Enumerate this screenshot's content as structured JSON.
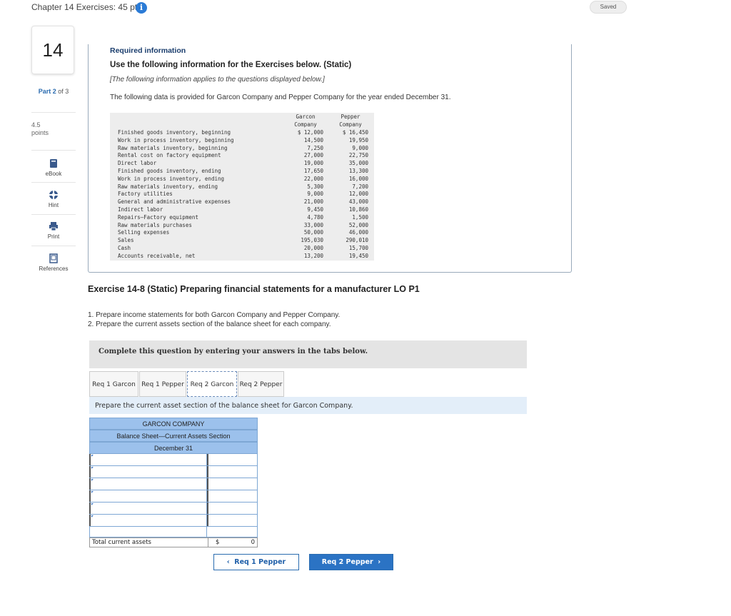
{
  "header": {
    "title": "Chapter 14 Exercises: 45 pts",
    "info_icon": "i",
    "saved": "Saved"
  },
  "sidebar": {
    "question_number": "14",
    "part_prefix": "Part ",
    "part_current": "2",
    "part_suffix": " of 3",
    "points_value": "4.5",
    "points_label": "points",
    "tools": [
      {
        "icon": "ebook-icon",
        "label": "eBook"
      },
      {
        "icon": "hint-icon",
        "label": "Hint"
      },
      {
        "icon": "print-icon",
        "label": "Print"
      },
      {
        "icon": "references-icon",
        "label": "References"
      }
    ]
  },
  "info": {
    "required": "Required information",
    "heading": "Use the following information for the Exercises below. (Static)",
    "applies": "[The following information applies to the questions displayed below.]",
    "provided": "The following data is provided for Garcon Company and Pepper Company for the year ended December 31.",
    "table": {
      "col1": [
        "Garcon",
        "Company"
      ],
      "col2": [
        "Pepper",
        "Company"
      ],
      "rows": [
        {
          "label": "Finished goods inventory, beginning",
          "garcon": "$ 12,000",
          "pepper": "$ 16,450"
        },
        {
          "label": "Work in process inventory, beginning",
          "garcon": "14,500",
          "pepper": "19,950"
        },
        {
          "label": "Raw materials inventory, beginning",
          "garcon": "7,250",
          "pepper": "9,000"
        },
        {
          "label": "Rental cost on factory equipment",
          "garcon": "27,000",
          "pepper": "22,750"
        },
        {
          "label": "Direct labor",
          "garcon": "19,000",
          "pepper": "35,000"
        },
        {
          "label": "Finished goods inventory, ending",
          "garcon": "17,650",
          "pepper": "13,300"
        },
        {
          "label": "Work in process inventory, ending",
          "garcon": "22,000",
          "pepper": "16,000"
        },
        {
          "label": "Raw materials inventory, ending",
          "garcon": "5,300",
          "pepper": "7,200"
        },
        {
          "label": "Factory utilities",
          "garcon": "9,000",
          "pepper": "12,000"
        },
        {
          "label": "General and administrative expenses",
          "garcon": "21,000",
          "pepper": "43,000"
        },
        {
          "label": "Indirect labor",
          "garcon": "9,450",
          "pepper": "10,860"
        },
        {
          "label": "Repairs—Factory equipment",
          "garcon": "4,780",
          "pepper": "1,500"
        },
        {
          "label": "Raw materials purchases",
          "garcon": "33,000",
          "pepper": "52,000"
        },
        {
          "label": "Selling expenses",
          "garcon": "50,000",
          "pepper": "46,000"
        },
        {
          "label": "Sales",
          "garcon": "195,030",
          "pepper": "290,010"
        },
        {
          "label": "Cash",
          "garcon": "20,000",
          "pepper": "15,700"
        },
        {
          "label": "Accounts receivable, net",
          "garcon": "13,200",
          "pepper": "19,450"
        }
      ]
    }
  },
  "exercise": {
    "title": "Exercise 14-8 (Static) Preparing financial statements for a manufacturer LO P1",
    "instructions": [
      "1. Prepare income statements for both Garcon Company and Pepper Company.",
      "2. Prepare the current assets section of the balance sheet for each company."
    ],
    "complete": "Complete this question by entering your answers in the tabs below.",
    "tabs": [
      "Req 1 Garcon",
      "Req 1 Pepper",
      "Req 2 Garcon",
      "Req 2 Pepper"
    ],
    "active_tab": "Req 2 Garcon",
    "prompt": "Prepare the current asset section of the balance sheet for Garcon Company."
  },
  "balance_sheet": {
    "company": "GARCON COMPANY",
    "title": "Balance Sheet—Current Assets Section",
    "date": "December 31",
    "input_rows": 6,
    "total_label": "Total current assets",
    "total_symbol": "$",
    "total_value": "0"
  },
  "nav": {
    "prev": "Req 1 Pepper",
    "next": "Req 2 Pepper"
  },
  "colors": {
    "accent": "#2b73c4",
    "header_blue": "#9cc1ec",
    "prompt_bg": "#e3eef9"
  }
}
